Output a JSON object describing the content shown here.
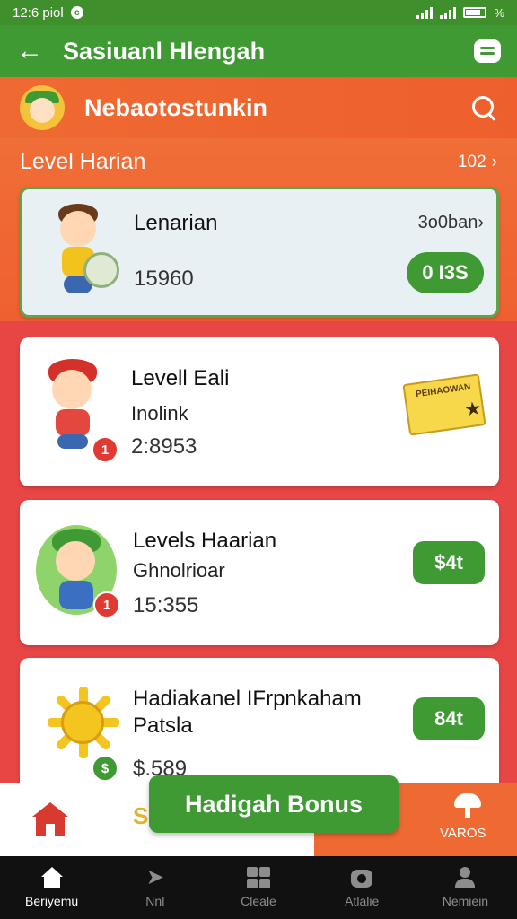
{
  "status_bar": {
    "time": "12:6 piol",
    "right_text": "%"
  },
  "app_bar": {
    "title": "Sasiuanl Hlengah",
    "back_icon": "arrow-left-icon",
    "chat_icon": "chat-bubble-icon"
  },
  "sub_bar": {
    "brand": "Nebaotostunkin",
    "search_icon": "search-icon"
  },
  "section": {
    "title": "Level Harian",
    "link_text": "102"
  },
  "featured": {
    "title": "Lenarian",
    "link_text": "3o0ban",
    "value": "15960",
    "button": "0 I3S"
  },
  "cards": [
    {
      "title": "Levell Eali",
      "subtitle": "Inolink",
      "value": "2:8953",
      "badge": "1",
      "ticket_text": "PEIHAOWAN"
    },
    {
      "title": "Levels Haarian",
      "subtitle": "Ghnolrioar",
      "value": "15:355",
      "badge": "1",
      "button": "$4t"
    },
    {
      "title": "Hadiakanel IFrpnkaham",
      "subtitle": "Patsla",
      "value": "$.589",
      "badge": "$",
      "button": "84t"
    }
  ],
  "bonus": {
    "label": "Hadigah Bonus",
    "right_label": "VAROS",
    "partial_text": "S"
  },
  "bottom_nav": [
    {
      "label": "Beriyemu",
      "icon": "home-icon",
      "active": true
    },
    {
      "label": "Nnl",
      "icon": "plane-icon",
      "active": false
    },
    {
      "label": "Cleale",
      "icon": "grid-icon",
      "active": false
    },
    {
      "label": "Atlalie",
      "icon": "camera-icon",
      "active": false
    },
    {
      "label": "Nemiein",
      "icon": "user-icon",
      "active": false
    }
  ]
}
